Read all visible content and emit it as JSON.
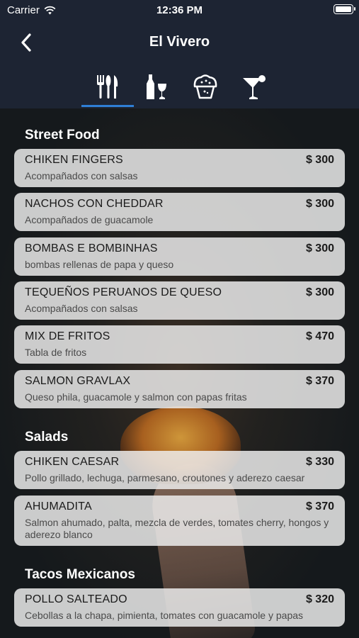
{
  "status": {
    "carrier": "Carrier",
    "time": "12:36 PM"
  },
  "header": {
    "title": "El Vivero"
  },
  "tabs": [
    {
      "icon": "cutlery-icon",
      "active": true
    },
    {
      "icon": "wine-icon",
      "active": false
    },
    {
      "icon": "cupcake-icon",
      "active": false
    },
    {
      "icon": "cocktail-icon",
      "active": false
    }
  ],
  "sections": [
    {
      "title": "Street Food",
      "items": [
        {
          "name": "CHIKEN FINGERS",
          "price": "$ 300",
          "desc": "Acompañados con salsas"
        },
        {
          "name": "NACHOS CON CHEDDAR",
          "price": "$ 300",
          "desc": "Acompañados de guacamole"
        },
        {
          "name": "BOMBAS E BOMBINHAS",
          "price": "$ 300",
          "desc": "bombas rellenas de papa y queso"
        },
        {
          "name": "TEQUEÑOS PERUANOS DE QUESO",
          "price": "$ 300",
          "desc": "Acompañados con salsas"
        },
        {
          "name": "MIX DE FRITOS",
          "price": "$ 470",
          "desc": "Tabla de fritos"
        },
        {
          "name": "SALMON GRAVLAX",
          "price": "$ 370",
          "desc": "Queso phila, guacamole y salmon con papas fritas"
        }
      ]
    },
    {
      "title": "Salads",
      "items": [
        {
          "name": "CHIKEN CAESAR",
          "price": "$ 330",
          "desc": "Pollo grillado, lechuga, parmesano, croutones y aderezo caesar"
        },
        {
          "name": "AHUMADITA",
          "price": "$ 370",
          "desc": "Salmon ahumado, palta, mezcla de verdes, tomates cherry, hongos y aderezo blanco"
        }
      ]
    },
    {
      "title": "Tacos Mexicanos",
      "items": [
        {
          "name": "POLLO SALTEADO",
          "price": "$ 320",
          "desc": "Cebollas a la chapa, pimienta, tomates con guacamole y papas"
        }
      ]
    }
  ],
  "colors": {
    "header_bg": "#1d2433",
    "active_tab": "#2f7fd6",
    "card_bg": "#eeeeee"
  }
}
